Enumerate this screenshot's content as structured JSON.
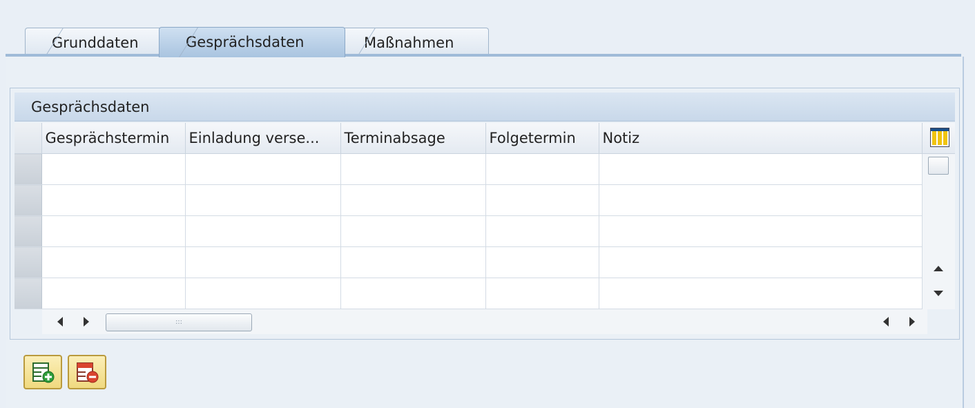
{
  "tabs": [
    {
      "label": "Grunddaten",
      "active": false
    },
    {
      "label": "Gesprächsdaten",
      "active": true
    },
    {
      "label": "Maßnahmen",
      "active": false
    }
  ],
  "group": {
    "title": "Gesprächsdaten"
  },
  "table": {
    "columns": [
      "Gesprächstermin",
      "Einladung verse...",
      "Terminabsage",
      "Folgetermin",
      "Notiz"
    ],
    "visible_row_count": 5
  },
  "toolbar": {
    "icons": [
      "insert-row-icon",
      "delete-row-icon"
    ]
  },
  "colors": {
    "accent": "#9fbbd8",
    "button": "#f0d97f"
  }
}
